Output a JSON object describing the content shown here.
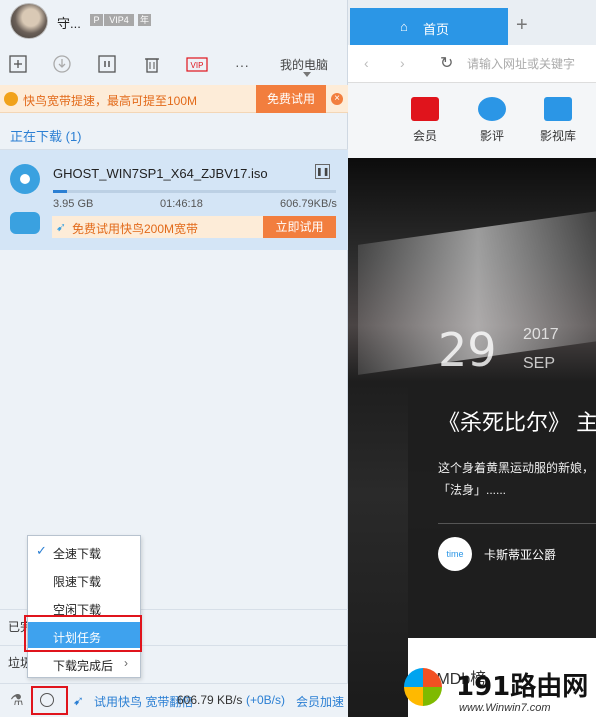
{
  "profile": {
    "name": "守...",
    "badge_p": "P",
    "badge_vip": "VIP4",
    "badge_year": "年"
  },
  "toolbar": {
    "my_pc": "我的电脑",
    "vip_label": "VIP",
    "more_label": "···"
  },
  "promo": {
    "text": "快鸟宽带提速，最高可提至100M",
    "button": "免费试用",
    "close": "×"
  },
  "section": {
    "downloading_title": "正在下载 (1)"
  },
  "task": {
    "name": "GHOST_WIN7SP1_X64_ZJBV17.iso",
    "size": "3.95 GB",
    "time": "01:46:18",
    "speed": "606.79KB/s",
    "progress": 0.05,
    "trial_text": "免费试用快鸟200M宽带",
    "trial_button": "立即试用"
  },
  "collapsed": {
    "done_label": "已完",
    "trash_label": "垃圾"
  },
  "menu": {
    "items": [
      {
        "label": "全速下载",
        "checked": true
      },
      {
        "label": "限速下载"
      },
      {
        "label": "空闲下载"
      },
      {
        "label": "计划任务",
        "selected": true
      },
      {
        "label": "下载完成后",
        "submenu": true
      }
    ]
  },
  "status": {
    "trial": "试用快鸟 宽带翻倍",
    "speed": "606.79 KB/s",
    "upload": "(+0B/s)",
    "accelerate": "会员加速"
  },
  "browser": {
    "tab_home": "首页",
    "address_placeholder": "请输入网址或关键字",
    "quicknav": [
      {
        "label": "会员",
        "color": "#e0141c"
      },
      {
        "label": "影评",
        "color": "#2b96e6"
      },
      {
        "label": "影视库",
        "color": "#2b96e6"
      }
    ],
    "date_day": "29",
    "date_year": "2017",
    "date_month": "SEP",
    "card_title": "《杀死比尔》 主",
    "card_desc": "这个身着黄黑运动服的新娘，「法身」......",
    "card_logo": "time",
    "card_author": "卡斯蒂亚公爵",
    "bottom_text": "IMDb榜"
  },
  "watermark": {
    "brand": "191路由网",
    "url": "www.Winwin7.com"
  },
  "colors": {
    "accent": "#2b96e6",
    "promo_orange": "#f27e3e",
    "highlight_red": "#e0141c",
    "selection": "#3ea2ee"
  }
}
